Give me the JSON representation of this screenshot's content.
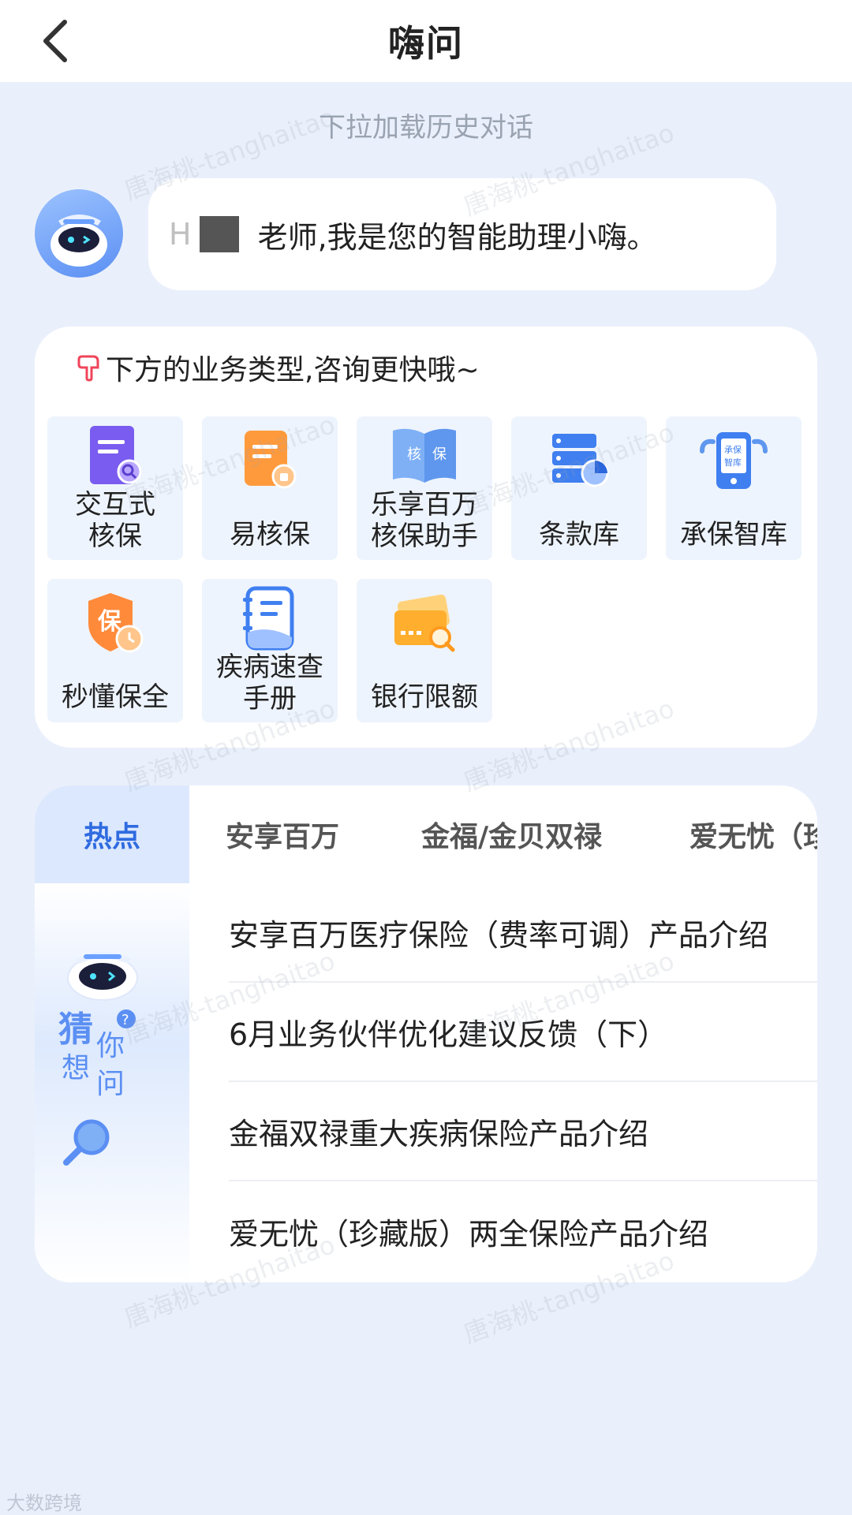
{
  "header": {
    "title": "嗨问",
    "back_icon": "chevron-left-icon"
  },
  "history_hint": "下拉加载历史对话",
  "greeting": {
    "name_visible": "H",
    "text": "老师,我是您的智能助理小嗨。"
  },
  "business": {
    "heading": "下方的业务类型,咨询更快哦~",
    "tiles": [
      {
        "label": "交互式\n核保",
        "icon": "document-search-icon"
      },
      {
        "label": "易核保",
        "icon": "document-stamp-icon"
      },
      {
        "label": "乐享百万\n核保助手",
        "icon": "book-icon",
        "icon_text_left": "核",
        "icon_text_right": "保"
      },
      {
        "label": "条款库",
        "icon": "database-chart-icon"
      },
      {
        "label": "承保智库",
        "icon": "phone-library-icon",
        "icon_text": "承保\n智库"
      },
      {
        "label": "秒懂保全",
        "icon": "shield-clock-icon",
        "icon_text": "保"
      },
      {
        "label": "疾病速查\n手册",
        "icon": "notebook-icon"
      },
      {
        "label": "银行限额",
        "icon": "card-search-icon"
      }
    ]
  },
  "faq": {
    "tabs": [
      "热点",
      "安享百万",
      "金福/金贝双禄",
      "爱无忧（珍"
    ],
    "side_label": [
      "猜",
      "你",
      "想",
      "问"
    ],
    "items": [
      "安享百万医疗保险（费率可调）产品介绍",
      "6月业务伙伴优化建议反馈（下）",
      "金福双禄重大疾病保险产品介绍",
      "爱无忧（珍藏版）两全保险产品介绍"
    ]
  },
  "watermark_text": "唐海桃-tanghaitao",
  "footer_mark": "大数跨境"
}
